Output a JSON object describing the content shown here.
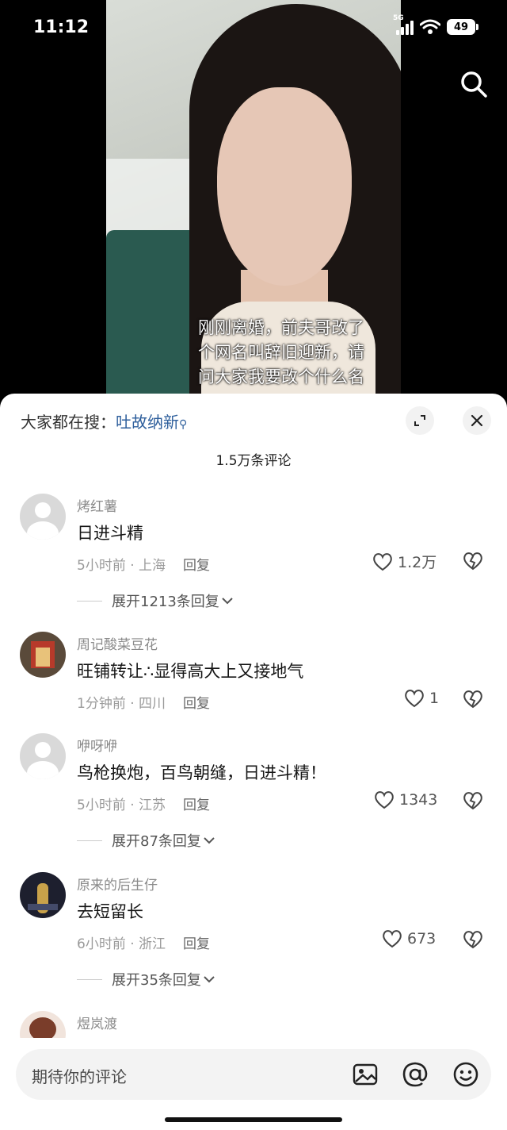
{
  "status": {
    "time": "11:12",
    "network": "5G",
    "battery": "49"
  },
  "video": {
    "caption_lines": [
      "刚刚离婚，前夫哥改了",
      "个网名叫辞旧迎新，请",
      "问大家我要改个什么名"
    ]
  },
  "sheet": {
    "search_prefix": "大家都在搜：",
    "search_term": "吐故纳新",
    "count_label": "1.5万条评论"
  },
  "comments": [
    {
      "username": "烤红薯",
      "content": "日进斗精",
      "time": "5小时前",
      "location": "上海",
      "reply": "回复",
      "likes": "1.2万",
      "expand": "展开1213条回复"
    },
    {
      "username": "周记酸菜豆花",
      "content": "旺铺转让∴显得高大上又接地气",
      "time": "1分钟前",
      "location": "四川",
      "reply": "回复",
      "likes": "1"
    },
    {
      "username": "咿呀咿",
      "content": "鸟枪换炮，百鸟朝缝，日进斗精！",
      "time": "5小时前",
      "location": "江苏",
      "reply": "回复",
      "likes": "1343",
      "expand": "展开87条回复"
    },
    {
      "username": "原来的后生仔",
      "content": "去短留长",
      "time": "6小时前",
      "location": "浙江",
      "reply": "回复",
      "likes": "673",
      "expand": "展开35条回复"
    },
    {
      "username": "煜岚渡"
    }
  ],
  "input": {
    "placeholder": "期待你的评论"
  },
  "colors": {
    "link_blue": "#2e5f9c",
    "sheet_bg": "#ffffff"
  },
  "icons": [
    "search-icon",
    "expand-icon",
    "close-icon",
    "heart-icon",
    "dislike-icon",
    "image-icon",
    "at-icon",
    "emoji-icon"
  ]
}
